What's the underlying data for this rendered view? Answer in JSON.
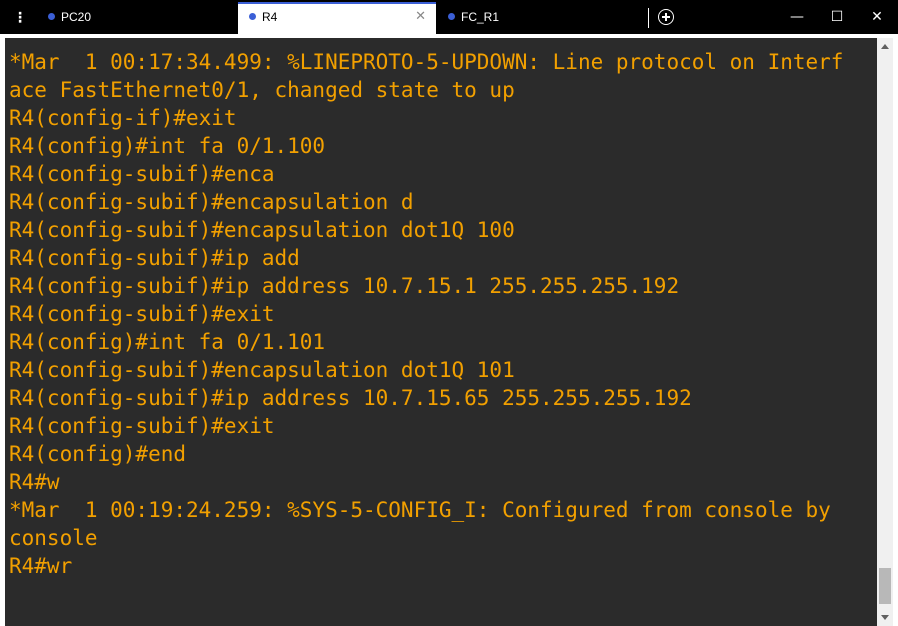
{
  "tabs": [
    {
      "label": "PC20",
      "dot_color": "#3b5fd6",
      "active": false
    },
    {
      "label": "R4",
      "dot_color": "#3b5fd6",
      "active": true
    },
    {
      "label": "FC_R1",
      "dot_color": "#3b5fd6",
      "active": false
    }
  ],
  "icons": {
    "menu": "vertical-dots-icon",
    "close_tab": "close-icon",
    "new_tab": "plus-circle-icon",
    "minimize": "minimize-icon",
    "maximize": "maximize-icon",
    "close_window": "close-icon"
  },
  "glyphs": {
    "menu": "⋮",
    "tab_close": "✕",
    "minimize": "—",
    "maximize": "☐",
    "close": "✕"
  },
  "console": {
    "text_color": "#f2a000",
    "background": "#2b2b2b",
    "lines": [
      "*Mar  1 00:17:34.499: %LINEPROTO-5-UPDOWN: Line protocol on Interf",
      "ace FastEthernet0/1, changed state to up",
      "R4(config-if)#exit",
      "R4(config)#int fa 0/1.100",
      "R4(config-subif)#enca",
      "R4(config-subif)#encapsulation d",
      "R4(config-subif)#encapsulation dot1Q 100",
      "R4(config-subif)#ip add",
      "R4(config-subif)#ip address 10.7.15.1 255.255.255.192",
      "R4(config-subif)#exit",
      "R4(config)#int fa 0/1.101",
      "R4(config-subif)#encapsulation dot1Q 101",
      "R4(config-subif)#ip address 10.7.15.65 255.255.255.192",
      "R4(config-subif)#exit",
      "R4(config)#end",
      "R4#w",
      "*Mar  1 00:19:24.259: %SYS-5-CONFIG_I: Configured from console by",
      "console",
      "R4#wr"
    ]
  }
}
